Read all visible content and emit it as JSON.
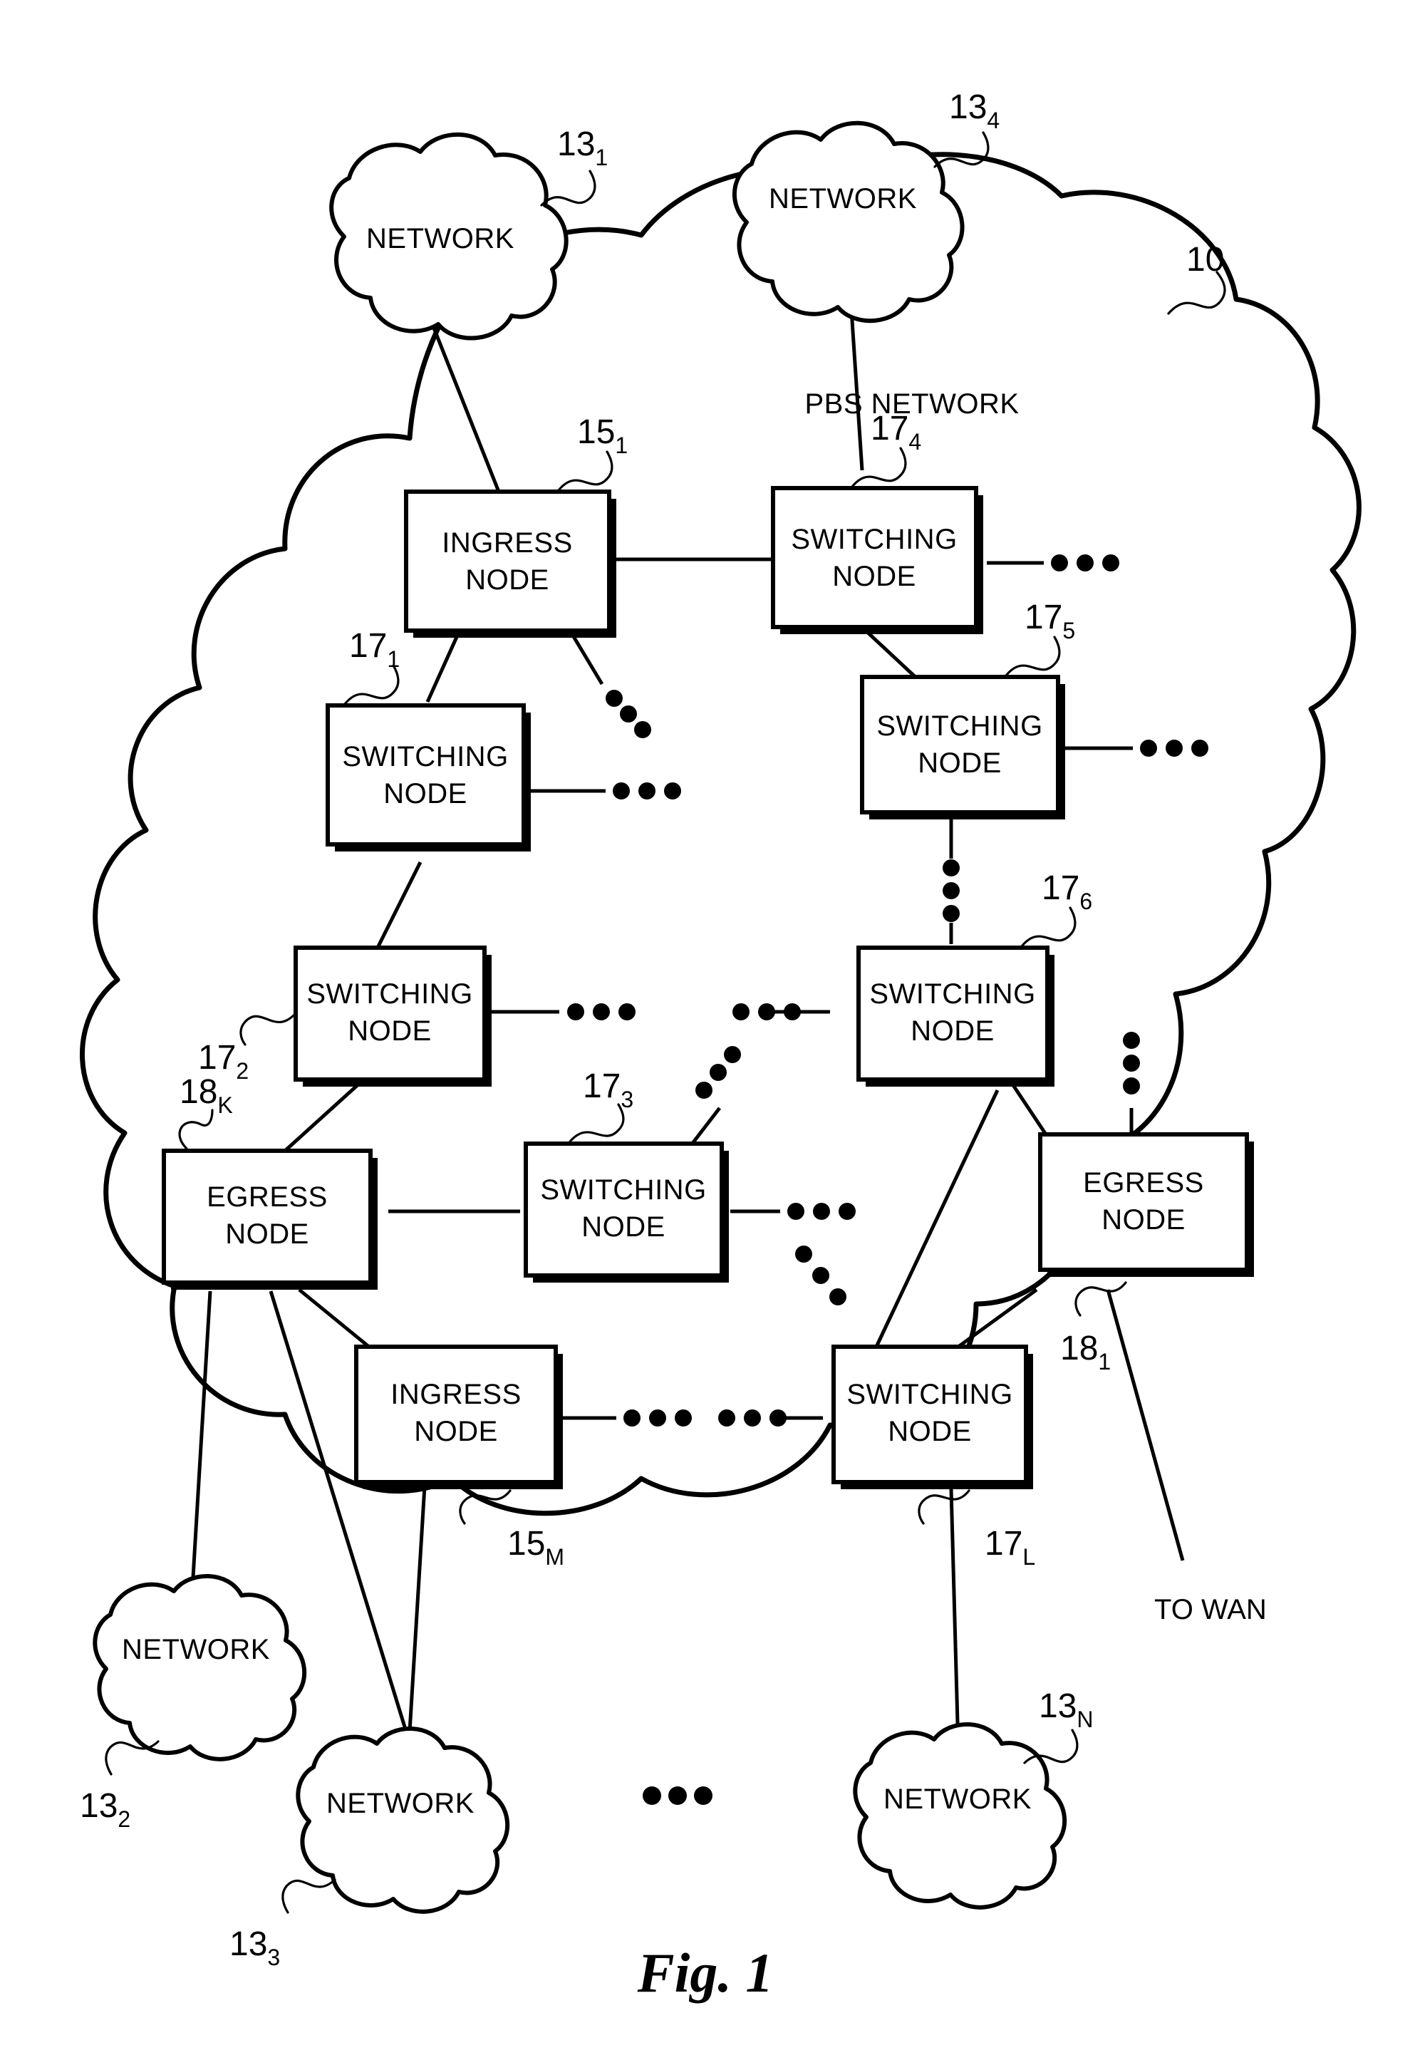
{
  "figure": {
    "caption": "Fig. 1",
    "pbs_network_label": "PBS NETWORK",
    "pbs_ref": {
      "num": "10",
      "sub": ""
    },
    "to_wan_label": "TO WAN"
  },
  "node_labels": {
    "ingress_line1": "INGRESS",
    "ingress_line2": "NODE",
    "switching_line1": "SWITCHING",
    "switching_line2": "NODE",
    "egress_line1": "EGRESS",
    "egress_line2": "NODE",
    "network": "NETWORK"
  },
  "clouds": [
    {
      "id": "net-13-1",
      "label": "NETWORK",
      "ref_num": "13",
      "ref_sub": "1"
    },
    {
      "id": "net-13-4",
      "label": "NETWORK",
      "ref_num": "13",
      "ref_sub": "4"
    },
    {
      "id": "net-13-2",
      "label": "NETWORK",
      "ref_num": "13",
      "ref_sub": "2"
    },
    {
      "id": "net-13-3",
      "label": "NETWORK",
      "ref_num": "13",
      "ref_sub": "3"
    },
    {
      "id": "net-13-n",
      "label": "NETWORK",
      "ref_num": "13",
      "ref_sub": "N"
    }
  ],
  "nodes": [
    {
      "id": "ingress-15-1",
      "type": "INGRESS NODE",
      "ref_num": "15",
      "ref_sub": "1"
    },
    {
      "id": "switching-17-4",
      "type": "SWITCHING NODE",
      "ref_num": "17",
      "ref_sub": "4"
    },
    {
      "id": "switching-17-1",
      "type": "SWITCHING NODE",
      "ref_num": "17",
      "ref_sub": "1"
    },
    {
      "id": "switching-17-5",
      "type": "SWITCHING NODE",
      "ref_num": "17",
      "ref_sub": "5"
    },
    {
      "id": "switching-17-2",
      "type": "SWITCHING NODE",
      "ref_num": "17",
      "ref_sub": "2"
    },
    {
      "id": "switching-17-6",
      "type": "SWITCHING NODE",
      "ref_num": "17",
      "ref_sub": "6"
    },
    {
      "id": "egress-18-k",
      "type": "EGRESS NODE",
      "ref_num": "18",
      "ref_sub": "K"
    },
    {
      "id": "switching-17-3",
      "type": "SWITCHING NODE",
      "ref_num": "17",
      "ref_sub": "3"
    },
    {
      "id": "egress-18-1",
      "type": "EGRESS NODE",
      "ref_num": "18",
      "ref_sub": "1"
    },
    {
      "id": "ingress-15-m",
      "type": "INGRESS NODE",
      "ref_num": "15",
      "ref_sub": "M"
    },
    {
      "id": "switching-17-l",
      "type": "SWITCHING NODE",
      "ref_num": "17",
      "ref_sub": "L"
    }
  ]
}
